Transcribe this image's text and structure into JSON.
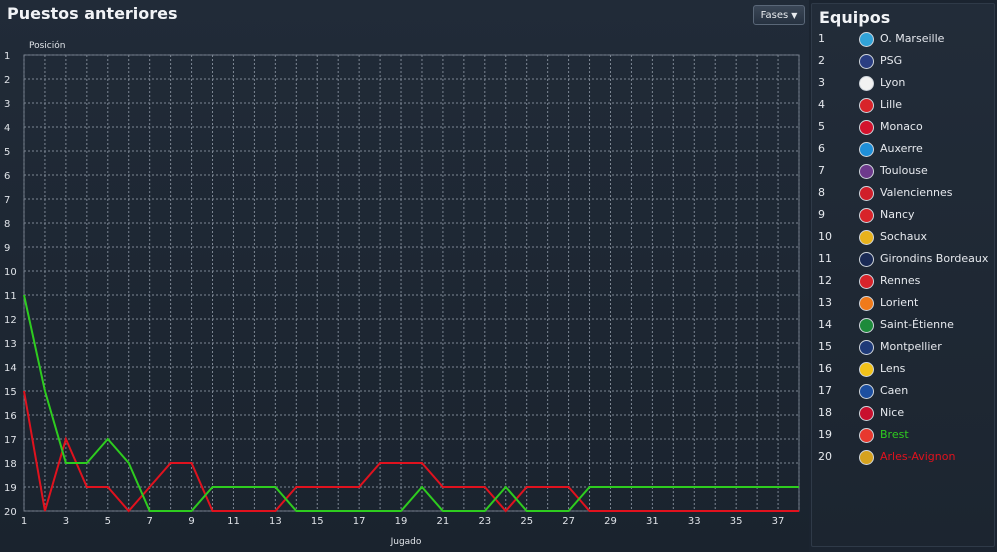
{
  "header": {
    "title": "Puestos anteriores",
    "fases_label": "Fases"
  },
  "colors": {
    "team_a": "#2ecc1f",
    "team_b": "#e0121e",
    "grid": "#7d8794",
    "background": "#1a232e"
  },
  "chart_data": {
    "type": "line",
    "title": "",
    "xlabel": "Jugado",
    "ylabel": "Posición",
    "xlim": [
      1,
      38
    ],
    "ylim": [
      1,
      20
    ],
    "y_inverted": true,
    "x_ticks": [
      "1",
      "3",
      "5",
      "7",
      "9",
      "11",
      "13",
      "15",
      "17",
      "19",
      "21",
      "23",
      "25",
      "27",
      "29",
      "31",
      "33",
      "35",
      "37"
    ],
    "y_ticks": [
      "1",
      "2",
      "3",
      "4",
      "5",
      "6",
      "7",
      "8",
      "9",
      "10",
      "11",
      "12",
      "13",
      "14",
      "15",
      "16",
      "17",
      "18",
      "19",
      "20"
    ],
    "grid": true,
    "x": [
      1,
      2,
      3,
      4,
      5,
      6,
      7,
      8,
      9,
      10,
      11,
      12,
      13,
      14,
      15,
      16,
      17,
      18,
      19,
      20,
      21,
      22,
      23,
      24,
      25,
      26,
      27,
      28,
      29,
      30,
      31,
      32,
      33,
      34,
      35,
      36,
      37,
      38
    ],
    "series": [
      {
        "name": "Brest",
        "color": "#2ecc1f",
        "values": [
          11,
          15,
          18,
          18,
          17,
          18,
          20,
          20,
          20,
          19,
          19,
          19,
          19,
          20,
          20,
          20,
          20,
          20,
          20,
          19,
          20,
          20,
          20,
          19,
          20,
          20,
          20,
          19,
          19,
          19,
          19,
          19,
          19,
          19,
          19,
          19,
          19,
          19
        ]
      },
      {
        "name": "Arles-Avignon",
        "color": "#e0121e",
        "values": [
          15,
          20,
          17,
          19,
          19,
          20,
          19,
          18,
          18,
          20,
          20,
          20,
          20,
          19,
          19,
          19,
          19,
          18,
          18,
          18,
          19,
          19,
          19,
          20,
          19,
          19,
          19,
          20,
          20,
          20,
          20,
          20,
          20,
          20,
          20,
          20,
          20,
          20
        ]
      }
    ]
  },
  "teams": {
    "title": "Equipos",
    "rows": [
      {
        "pos": "1",
        "name": "O. Marseille",
        "crest": "om-crest-icon",
        "color": "#e6e9ee",
        "crest_color": "#31a3d8"
      },
      {
        "pos": "2",
        "name": "PSG",
        "crest": "psg-crest-icon",
        "color": "#e6e9ee",
        "crest_color": "#2a3e82"
      },
      {
        "pos": "3",
        "name": "Lyon",
        "crest": "lyon-crest-icon",
        "color": "#e6e9ee",
        "crest_color": "#f2f2f2"
      },
      {
        "pos": "4",
        "name": "Lille",
        "crest": "lille-crest-icon",
        "color": "#e6e9ee",
        "crest_color": "#d8232a"
      },
      {
        "pos": "5",
        "name": "Monaco",
        "crest": "monaco-crest-icon",
        "color": "#e6e9ee",
        "crest_color": "#d3122d"
      },
      {
        "pos": "6",
        "name": "Auxerre",
        "crest": "auxerre-crest-icon",
        "color": "#e6e9ee",
        "crest_color": "#1f8fd8"
      },
      {
        "pos": "7",
        "name": "Toulouse",
        "crest": "toulouse-crest-icon",
        "color": "#e6e9ee",
        "crest_color": "#6d3a8c"
      },
      {
        "pos": "8",
        "name": "Valenciennes",
        "crest": "valenciennes-crest-icon",
        "color": "#e6e9ee",
        "crest_color": "#d01f2a"
      },
      {
        "pos": "9",
        "name": "Nancy",
        "crest": "nancy-crest-icon",
        "color": "#e6e9ee",
        "crest_color": "#d8232a"
      },
      {
        "pos": "10",
        "name": "Sochaux",
        "crest": "sochaux-crest-icon",
        "color": "#e6e9ee",
        "crest_color": "#e8b21c"
      },
      {
        "pos": "11",
        "name": "Girondins Bordeaux",
        "crest": "bordeaux-crest-icon",
        "color": "#e6e9ee",
        "crest_color": "#1a2a55"
      },
      {
        "pos": "12",
        "name": "Rennes",
        "crest": "rennes-crest-icon",
        "color": "#e6e9ee",
        "crest_color": "#d8232a"
      },
      {
        "pos": "13",
        "name": "Lorient",
        "crest": "lorient-crest-icon",
        "color": "#e6e9ee",
        "crest_color": "#f07a1a"
      },
      {
        "pos": "14",
        "name": "Saint-Étienne",
        "crest": "saint-etienne-crest-icon",
        "color": "#e6e9ee",
        "crest_color": "#1d8a3a"
      },
      {
        "pos": "15",
        "name": "Montpellier",
        "crest": "montpellier-crest-icon",
        "color": "#e6e9ee",
        "crest_color": "#1e3a78"
      },
      {
        "pos": "16",
        "name": "Lens",
        "crest": "lens-crest-icon",
        "color": "#e6e9ee",
        "crest_color": "#f2c21a"
      },
      {
        "pos": "17",
        "name": "Caen",
        "crest": "caen-crest-icon",
        "color": "#e6e9ee",
        "crest_color": "#1d4fa0"
      },
      {
        "pos": "18",
        "name": "Nice",
        "crest": "nice-crest-icon",
        "color": "#e6e9ee",
        "crest_color": "#c8102e"
      },
      {
        "pos": "19",
        "name": "Brest",
        "crest": "brest-crest-icon",
        "color": "#2ecc1f",
        "crest_color": "#e8382e"
      },
      {
        "pos": "20",
        "name": "Arles-Avignon",
        "crest": "arles-avignon-crest-icon",
        "color": "#e0121e",
        "crest_color": "#d6a21e"
      }
    ]
  }
}
